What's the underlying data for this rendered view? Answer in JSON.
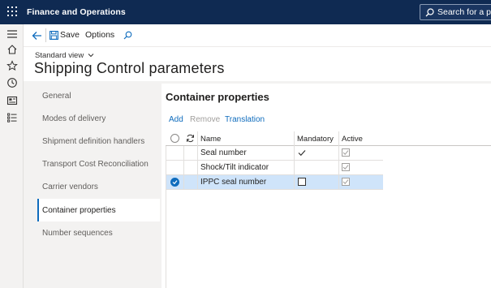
{
  "app": {
    "title": "Finance and Operations",
    "search_label": "Search for a page"
  },
  "actionbar": {
    "save_label": "Save",
    "options_label": "Options"
  },
  "header": {
    "view_selector": "Standard view",
    "page_title": "Shipping Control parameters"
  },
  "tabs": [
    {
      "label": "General"
    },
    {
      "label": "Modes of delivery"
    },
    {
      "label": "Shipment definition handlers"
    },
    {
      "label": "Transport Cost Reconciliation"
    },
    {
      "label": "Carrier vendors"
    },
    {
      "label": "Container properties"
    },
    {
      "label": "Number sequences"
    }
  ],
  "selected_tab": "Container properties",
  "section": {
    "title": "Container properties",
    "actions": {
      "add": "Add",
      "remove": "Remove",
      "translation": "Translation"
    }
  },
  "grid": {
    "columns": {
      "name": "Name",
      "mandatory": "Mandatory",
      "active": "Active"
    },
    "rows": [
      {
        "name": "Seal number",
        "mandatory": true,
        "active": true,
        "selected": false
      },
      {
        "name": "Shock/Tilt indicator",
        "mandatory": false,
        "active": true,
        "selected": false
      },
      {
        "name": "IPPC seal number",
        "mandatory": false,
        "active": true,
        "selected": true
      }
    ]
  },
  "colors": {
    "topbar": "#0f2a52",
    "accent": "#0f6cbd",
    "selected_row": "#cfe4fa",
    "workspace": "#f3f2f1"
  }
}
